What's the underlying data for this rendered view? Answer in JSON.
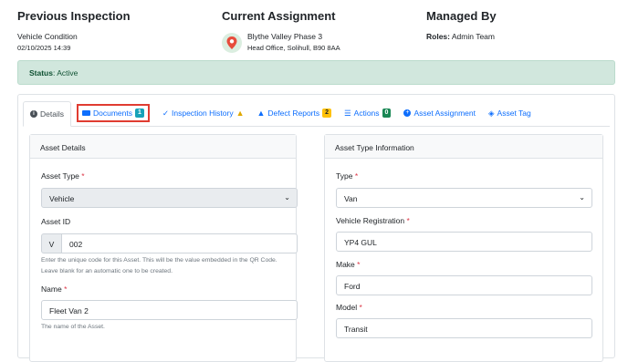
{
  "previous_inspection": {
    "title": "Previous Inspection",
    "label": "Vehicle Condition",
    "date": "02/10/2025 14:39"
  },
  "current_assignment": {
    "title": "Current Assignment",
    "name": "Blythe Valley Phase 3",
    "address": "Head Office, Solihull, B90 8AA",
    "icon": "map-location-icon"
  },
  "managed_by": {
    "title": "Managed By",
    "roles_label": "Roles:",
    "roles_value": "Admin Team"
  },
  "status": {
    "label": "Status",
    "value": ": Active",
    "color": "#d1e7dd"
  },
  "tabs": [
    {
      "label": "Details",
      "icon": "info-circle-icon",
      "active": true
    },
    {
      "label": "Documents",
      "icon": "folder-icon",
      "badge": "1"
    },
    {
      "label": "Inspection History",
      "icon": "check-icon",
      "warning": "▲"
    },
    {
      "label": "Defect Reports",
      "icon": "warning-triangle-icon",
      "badge": "2"
    },
    {
      "label": "Actions",
      "icon": "list-icon",
      "badge": "0"
    },
    {
      "label": "Asset Assignment",
      "icon": "plus-circle-icon"
    },
    {
      "label": "Asset Tag",
      "icon": "tag-icon"
    }
  ],
  "asset_details": {
    "header": "Asset Details",
    "asset_type": {
      "label": "Asset Type",
      "required": "*",
      "value": "Vehicle"
    },
    "asset_id": {
      "label": "Asset ID",
      "prefix": "V",
      "value": "002",
      "help_1": "Enter the unique code for this Asset. This will be the value embedded in the QR Code.",
      "help_2": "Leave blank for an automatic one to be created."
    },
    "name": {
      "label": "Name",
      "required": "*",
      "value": "Fleet Van 2",
      "help": "The name of the Asset."
    }
  },
  "asset_type_info": {
    "header": "Asset Type Information",
    "type": {
      "label": "Type",
      "required": "*",
      "value": "Van"
    },
    "registration": {
      "label": "Vehicle Registration",
      "required": "*",
      "value": "YP4 GUL"
    },
    "make": {
      "label": "Make",
      "required": "*",
      "value": "Ford"
    },
    "model": {
      "label": "Model",
      "required": "*",
      "value": "Transit"
    }
  },
  "colors": {
    "accent": "#0d6efd",
    "highlight": "#e03c31"
  }
}
